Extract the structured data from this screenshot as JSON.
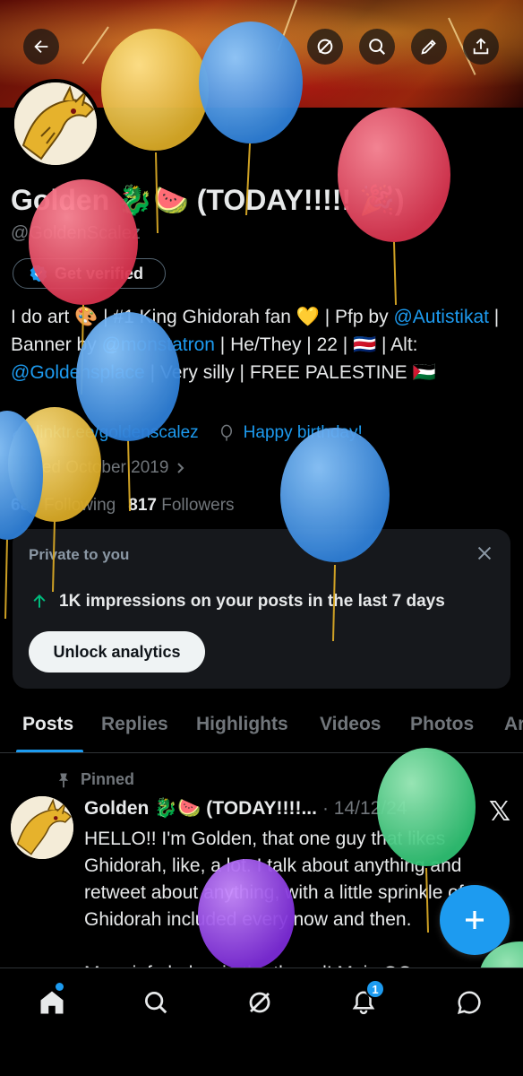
{
  "header": {
    "back_icon": "arrow-left-icon",
    "actions": [
      "grok-icon",
      "search-icon",
      "edit-icon",
      "share-icon"
    ]
  },
  "profile": {
    "name": "Golden 🐉🍉 (TODAY!!!!! 🎉)",
    "handle": "@GoldenScalez",
    "verify_label": "Get verified",
    "bio_parts": [
      {
        "text": "I do art 🎨 | #1 King Ghidorah fan 💛 | Pfp by ",
        "link": false
      },
      {
        "text": "@Autistikat",
        "link": true
      },
      {
        "text": " | Banner by ",
        "link": false
      },
      {
        "text": "@monstatron",
        "link": true
      },
      {
        "text": " | He/They | 22 | 🇨🇷 | Alt: ",
        "link": false
      },
      {
        "text": "@Goldensplace",
        "link": true
      },
      {
        "text": " | Very silly | FREE PALESTINE 🇵🇸",
        "link": false
      }
    ],
    "website": "linktr.ee/goldenscalez",
    "birthday": "Happy birthday!",
    "joined": "Joined October 2019",
    "following_count": "687",
    "following_label": "Following",
    "followers_count": "817",
    "followers_label": "Followers"
  },
  "analytics_card": {
    "label": "Private to you",
    "message": "1K impressions on your posts in the last 7 days",
    "button": "Unlock analytics"
  },
  "tabs": [
    "Posts",
    "Replies",
    "Highlights",
    "Videos",
    "Photos",
    "Articles"
  ],
  "active_tab": "Posts",
  "post": {
    "pinned_label": "Pinned",
    "author": "Golden 🐉🍉 (TODAY!!!!...",
    "date": "· 14/12/24",
    "body_1": "HELLO!! I'm Golden, that one guy that likes Ghidorah, like, a lot. I talk about anything and retweet about anything, with a little sprinkle of Ghidorah included every now and then.",
    "body_2": "More info below in the thread! Main OC"
  },
  "bottom_nav": {
    "items": [
      "home-icon",
      "search-icon",
      "grok-icon",
      "notifications-icon",
      "messages-icon"
    ],
    "notification_count": "1"
  },
  "colors": {
    "accent": "#1d9bf0",
    "background": "#000000",
    "card": "#16181c",
    "muted": "#71767b"
  }
}
